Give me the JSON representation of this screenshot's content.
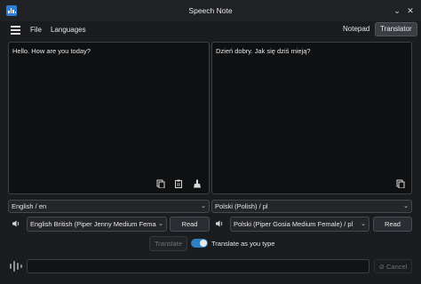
{
  "window": {
    "title": "Speech Note"
  },
  "menu": {
    "file": "File",
    "languages": "Languages"
  },
  "tabs": {
    "notepad": "Notepad",
    "translator": "Translator"
  },
  "source": {
    "text": "Hello. How are you today?",
    "language": "English / en",
    "voice": "English British (Piper Jenny Medium Female",
    "read_label": "Read"
  },
  "target": {
    "text": "Dzień dobry. Jak się dziś mieją?",
    "language": "Polski (Polish) / pl",
    "voice": "Polski (Piper Gosia Medium Female) / pl",
    "read_label": "Read"
  },
  "controls": {
    "translate_label": "Translate",
    "translate_as_you_type_label": "Translate as you type",
    "translate_as_you_type_enabled": true,
    "cancel_label": "Cancel"
  },
  "colors": {
    "accent": "#2f7fc4",
    "app_icon": "#2b7fd8"
  }
}
